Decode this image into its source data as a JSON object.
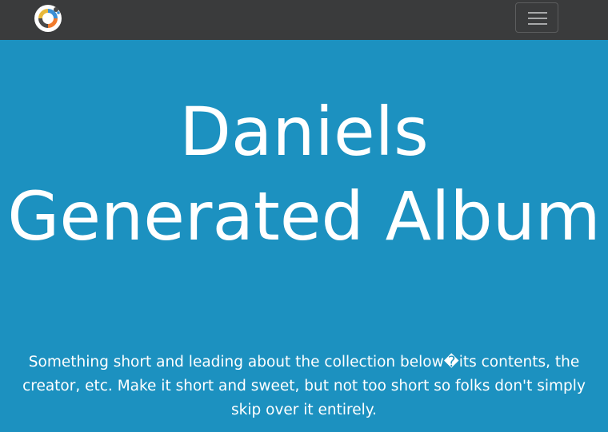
{
  "navbar": {
    "logo": "gear-logo",
    "toggle_icon": "hamburger-menu-icon",
    "colors": {
      "background": "#3a3b3c"
    }
  },
  "hero": {
    "title": "Daniels Generated Album",
    "lead": "Something short and leading about the collection below�its contents, the creator, etc. Make it short and sweet, but not too short so folks don't simply skip over it entirely.",
    "colors": {
      "background": "#1c91c0",
      "text": "#ffffff"
    }
  }
}
